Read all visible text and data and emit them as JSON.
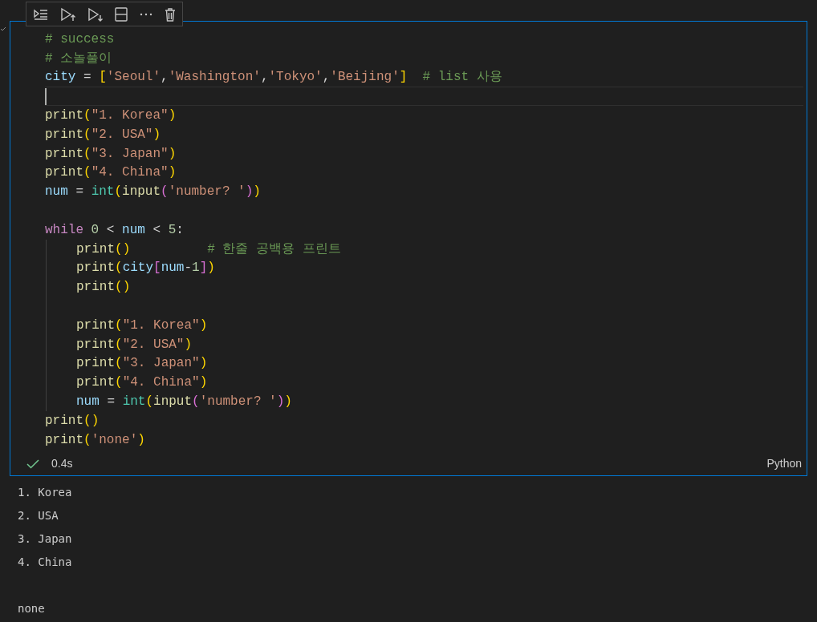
{
  "cell": {
    "toolbar": [
      {
        "kind": "run-by-line"
      },
      {
        "kind": "run-above"
      },
      {
        "kind": "run-below"
      },
      {
        "kind": "split"
      },
      {
        "kind": "more"
      },
      {
        "kind": "delete"
      }
    ],
    "lines": [
      {
        "kind": "code",
        "tokens": [
          {
            "t": "# success",
            "kind": "comment"
          }
        ]
      },
      {
        "kind": "code",
        "tokens": [
          {
            "t": "# 소놀풀이",
            "kind": "comment"
          }
        ]
      },
      {
        "kind": "code",
        "tokens": [
          {
            "t": "city",
            "kind": "var"
          },
          {
            "t": " = ",
            "kind": "op"
          },
          {
            "t": "[",
            "kind": "b1"
          },
          {
            "t": "'Seoul'",
            "kind": "str"
          },
          {
            "t": ",",
            "kind": "op"
          },
          {
            "t": "'Washington'",
            "kind": "str"
          },
          {
            "t": ",",
            "kind": "op"
          },
          {
            "t": "'Tokyo'",
            "kind": "str"
          },
          {
            "t": ",",
            "kind": "op"
          },
          {
            "t": "'Beijing'",
            "kind": "str"
          },
          {
            "t": "]",
            "kind": "b1"
          },
          {
            "t": "  # list 사용",
            "kind": "comment"
          }
        ]
      },
      {
        "kind": "blank",
        "current": true
      },
      {
        "kind": "code",
        "tokens": [
          {
            "t": "print",
            "kind": "fn"
          },
          {
            "t": "(",
            "kind": "b1"
          },
          {
            "t": "\"1. Korea\"",
            "kind": "str"
          },
          {
            "t": ")",
            "kind": "b1"
          }
        ]
      },
      {
        "kind": "code",
        "tokens": [
          {
            "t": "print",
            "kind": "fn"
          },
          {
            "t": "(",
            "kind": "b1"
          },
          {
            "t": "\"2. USA\"",
            "kind": "str"
          },
          {
            "t": ")",
            "kind": "b1"
          }
        ]
      },
      {
        "kind": "code",
        "tokens": [
          {
            "t": "print",
            "kind": "fn"
          },
          {
            "t": "(",
            "kind": "b1"
          },
          {
            "t": "\"3. Japan\"",
            "kind": "str"
          },
          {
            "t": ")",
            "kind": "b1"
          }
        ]
      },
      {
        "kind": "code",
        "tokens": [
          {
            "t": "print",
            "kind": "fn"
          },
          {
            "t": "(",
            "kind": "b1"
          },
          {
            "t": "\"4. China\"",
            "kind": "str"
          },
          {
            "t": ")",
            "kind": "b1"
          }
        ]
      },
      {
        "kind": "code",
        "tokens": [
          {
            "t": "num",
            "kind": "var"
          },
          {
            "t": " = ",
            "kind": "op"
          },
          {
            "t": "int",
            "kind": "type"
          },
          {
            "t": "(",
            "kind": "b1"
          },
          {
            "t": "input",
            "kind": "fn"
          },
          {
            "t": "(",
            "kind": "b2"
          },
          {
            "t": "'number? '",
            "kind": "str"
          },
          {
            "t": ")",
            "kind": "b2"
          },
          {
            "t": ")",
            "kind": "b1"
          }
        ]
      },
      {
        "kind": "blank"
      },
      {
        "kind": "code",
        "tokens": [
          {
            "t": "while ",
            "kind": "kw"
          },
          {
            "t": "0",
            "kind": "num"
          },
          {
            "t": " < ",
            "kind": "op"
          },
          {
            "t": "num",
            "kind": "var"
          },
          {
            "t": " < ",
            "kind": "op"
          },
          {
            "t": "5",
            "kind": "num"
          },
          {
            "t": ":",
            "kind": "op"
          }
        ],
        "children": [
          {
            "kind": "code",
            "tokens": [
              {
                "t": "print",
                "kind": "fn"
              },
              {
                "t": "(",
                "kind": "b1"
              },
              {
                "t": ")",
                "kind": "b1"
              },
              {
                "t": "          # 한줄 공백용 프린트",
                "kind": "comment"
              }
            ]
          },
          {
            "kind": "code",
            "tokens": [
              {
                "t": "print",
                "kind": "fn"
              },
              {
                "t": "(",
                "kind": "b1"
              },
              {
                "t": "city",
                "kind": "var"
              },
              {
                "t": "[",
                "kind": "b2"
              },
              {
                "t": "num",
                "kind": "var"
              },
              {
                "t": "-",
                "kind": "op"
              },
              {
                "t": "1",
                "kind": "num"
              },
              {
                "t": "]",
                "kind": "b2"
              },
              {
                "t": ")",
                "kind": "b1"
              }
            ]
          },
          {
            "kind": "code",
            "tokens": [
              {
                "t": "print",
                "kind": "fn"
              },
              {
                "t": "(",
                "kind": "b1"
              },
              {
                "t": ")",
                "kind": "b1"
              }
            ]
          },
          {
            "kind": "blank"
          },
          {
            "kind": "code",
            "tokens": [
              {
                "t": "print",
                "kind": "fn"
              },
              {
                "t": "(",
                "kind": "b1"
              },
              {
                "t": "\"1. Korea\"",
                "kind": "str"
              },
              {
                "t": ")",
                "kind": "b1"
              }
            ]
          },
          {
            "kind": "code",
            "tokens": [
              {
                "t": "print",
                "kind": "fn"
              },
              {
                "t": "(",
                "kind": "b1"
              },
              {
                "t": "\"2. USA\"",
                "kind": "str"
              },
              {
                "t": ")",
                "kind": "b1"
              }
            ]
          },
          {
            "kind": "code",
            "tokens": [
              {
                "t": "print",
                "kind": "fn"
              },
              {
                "t": "(",
                "kind": "b1"
              },
              {
                "t": "\"3. Japan\"",
                "kind": "str"
              },
              {
                "t": ")",
                "kind": "b1"
              }
            ]
          },
          {
            "kind": "code",
            "tokens": [
              {
                "t": "print",
                "kind": "fn"
              },
              {
                "t": "(",
                "kind": "b1"
              },
              {
                "t": "\"4. China\"",
                "kind": "str"
              },
              {
                "t": ")",
                "kind": "b1"
              }
            ]
          },
          {
            "kind": "code",
            "tokens": [
              {
                "t": "num",
                "kind": "var"
              },
              {
                "t": " = ",
                "kind": "op"
              },
              {
                "t": "int",
                "kind": "type"
              },
              {
                "t": "(",
                "kind": "b1"
              },
              {
                "t": "input",
                "kind": "fn"
              },
              {
                "t": "(",
                "kind": "b2"
              },
              {
                "t": "'number? '",
                "kind": "str"
              },
              {
                "t": ")",
                "kind": "b2"
              },
              {
                "t": ")",
                "kind": "b1"
              }
            ]
          }
        ]
      },
      {
        "kind": "code",
        "tokens": [
          {
            "t": "print",
            "kind": "fn"
          },
          {
            "t": "(",
            "kind": "b1"
          },
          {
            "t": ")",
            "kind": "b1"
          }
        ]
      },
      {
        "kind": "code",
        "tokens": [
          {
            "t": "print",
            "kind": "fn"
          },
          {
            "t": "(",
            "kind": "b1"
          },
          {
            "t": "'none'",
            "kind": "str"
          },
          {
            "t": ")",
            "kind": "b1"
          }
        ]
      }
    ],
    "status": {
      "success": true,
      "time": "0.4s",
      "language": "Python"
    }
  },
  "output": [
    {
      "lines": [
        "1. Korea",
        "2. USA",
        "3. Japan",
        "4. China"
      ]
    },
    {
      "lines": [
        "none"
      ]
    }
  ]
}
